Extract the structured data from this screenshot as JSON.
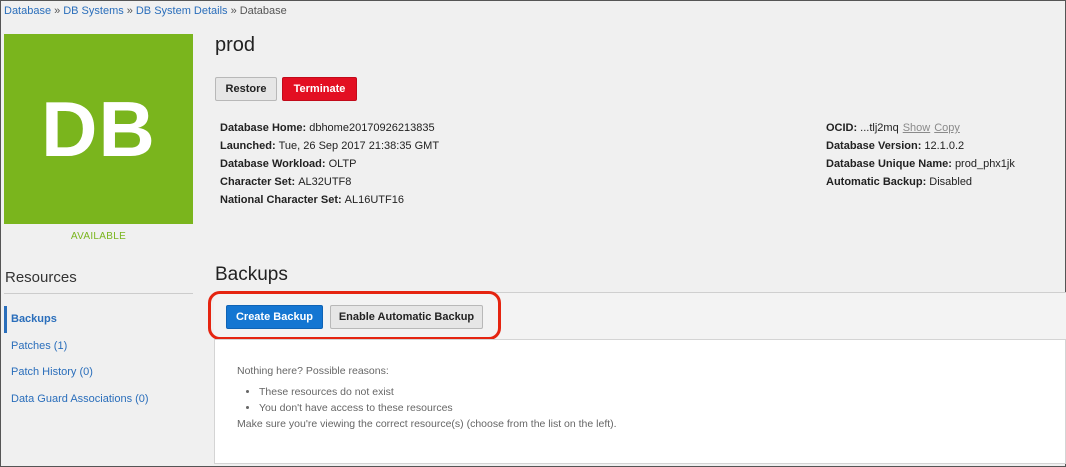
{
  "breadcrumb": {
    "items": [
      "Database",
      "DB Systems",
      "DB System Details"
    ],
    "current": "Database",
    "separator": "»"
  },
  "tile": {
    "label": "DB",
    "color": "#7ab51d"
  },
  "status": "AVAILABLE",
  "resources": {
    "title": "Resources",
    "items": [
      {
        "label": "Backups",
        "active": true
      },
      {
        "label": "Patches (1)"
      },
      {
        "label": "Patch History (0)"
      },
      {
        "label": "Data Guard Associations (0)"
      }
    ]
  },
  "page": {
    "title": "prod"
  },
  "actions": {
    "restore": "Restore",
    "terminate": "Terminate"
  },
  "details_left": [
    {
      "label": "Database Home:",
      "value": "dbhome20170926213835"
    },
    {
      "label": "Launched:",
      "value": "Tue, 26 Sep 2017 21:38:35 GMT"
    },
    {
      "label": "Database Workload:",
      "value": "OLTP"
    },
    {
      "label": "Character Set:",
      "value": "AL32UTF8"
    },
    {
      "label": "National Character Set:",
      "value": "AL16UTF16"
    }
  ],
  "details_right": {
    "ocid": {
      "label": "OCID:",
      "value": "...tlj2mq",
      "show": "Show",
      "copy": "Copy"
    },
    "rows": [
      {
        "label": "Database Version:",
        "value": "12.1.0.2"
      },
      {
        "label": "Database Unique Name:",
        "value": "prod_phx1jk"
      },
      {
        "label": "Automatic Backup:",
        "value": "Disabled"
      }
    ]
  },
  "backups": {
    "title": "Backups",
    "create_button": "Create Backup",
    "enable_button": "Enable Automatic Backup",
    "empty": {
      "heading": "Nothing here? Possible reasons:",
      "reasons": [
        "These resources do not exist",
        "You don't have access to these resources"
      ],
      "footer": "Make sure you're viewing the correct resource(s) (choose from the list on the left)."
    }
  },
  "colors": {
    "accent": "#1476d2",
    "danger": "#e30f22",
    "highlight": "#e52410",
    "link": "#2a6ebb"
  }
}
